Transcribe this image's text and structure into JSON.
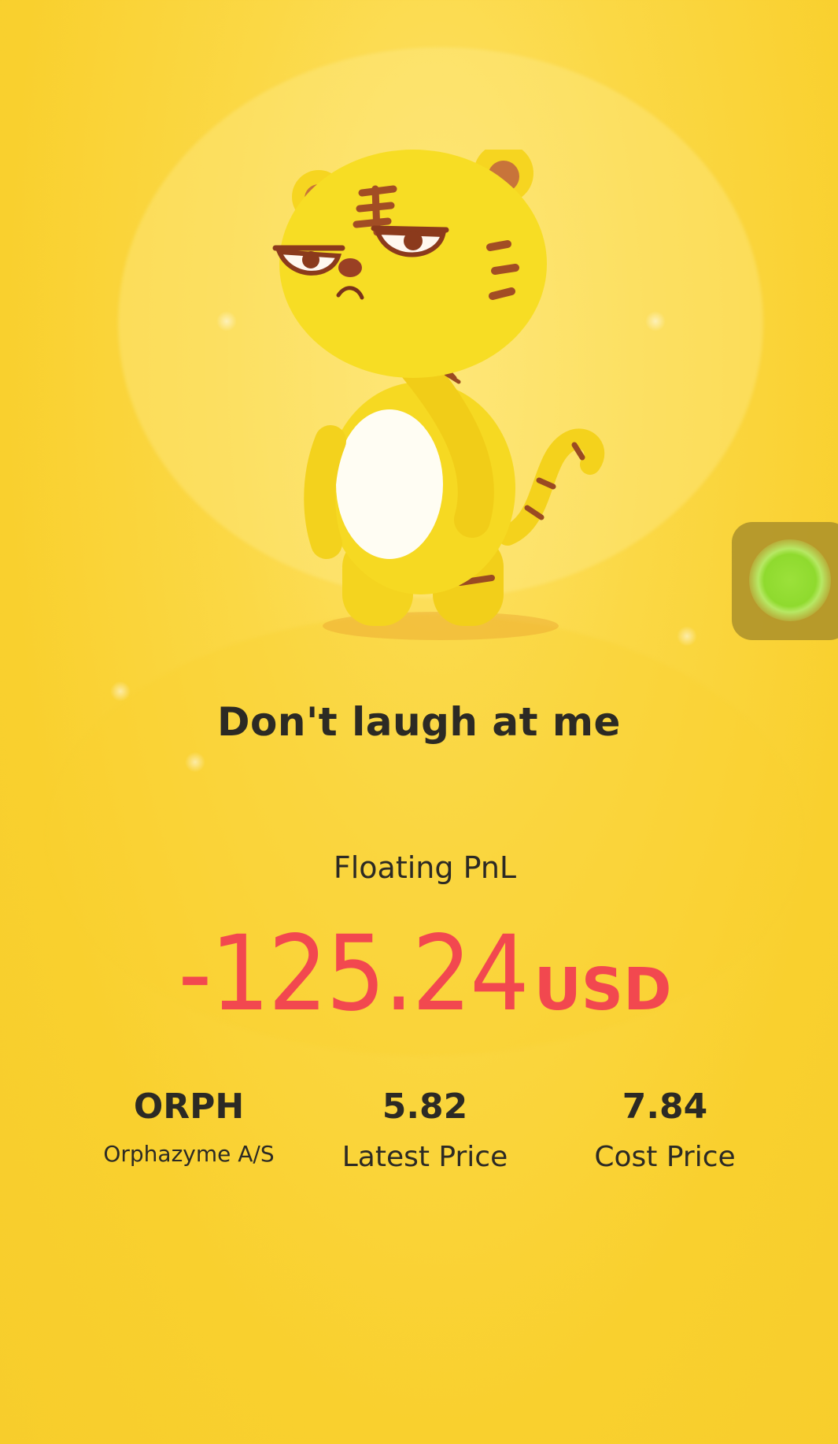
{
  "headline": "Don't laugh at me",
  "pnl": {
    "label": "Floating PnL",
    "value": "-125.24",
    "currency": "USD"
  },
  "position": {
    "symbol": "ORPH",
    "company": "Orphazyme A/S",
    "latest_price": "5.82",
    "latest_price_label": "Latest Price",
    "cost_price": "7.84",
    "cost_price_label": "Cost Price"
  },
  "icons": {
    "mascot": "tiger-mascot-icon",
    "floating_button": "floating-assistant-icon"
  },
  "colors": {
    "background": "#f9d02e",
    "loss": "#f2484f",
    "text": "#2c2a24",
    "accent_green": "#8fda2e"
  }
}
